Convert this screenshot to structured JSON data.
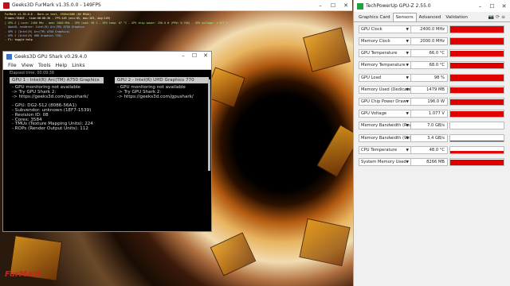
{
  "furmark": {
    "title": "Geeks3D FurMark v1.35.0.0 - 149FPS",
    "info_lines": [
      "FurMark v1.35.0.0 - Burn-in test, 1920x1080 (0X MSAA)",
      "Frames:78465 - time:00:08:36 - FPS:149 (min:65, max:163, avg:149)",
      "[ GPU-Z ] core: 2400 MHz - mem: 2000 MHz - GPU load: 98 % - GPU temp: 67 °C - GPU chip power: 196.0 W (PPW: 0.760) - GPU voltage: 1.077 V",
      "- OpenGL renderer: Intel(R) Arc(TM) A750 Graphics",
      "- GPU 1 (Intel(R) Arc(TM) A750 Graphics)",
      "- GPU 2 (Intel(R) UHD Graphics 770)",
      "- F1: toggle help"
    ],
    "logo_text": "FurMark"
  },
  "shark": {
    "title": "Geeks3D GPU Shark v0.29.4.0",
    "menu": [
      "File",
      "View",
      "Tools",
      "Help",
      "Links"
    ],
    "elapsed": "Elapsed time: 00:09:38",
    "gpu1": {
      "header": "GPU 1 - Intel(R) Arc(TM) A750 Graphics",
      "lines": [
        "- GPU monitoring not available",
        "  -> Try GPU Shark 2:",
        "  -> https://geeks3d.com/gpushark/",
        "",
        "- GPU: DG2-512 (8086-56A1)",
        "- Subvendor: unknown (1EF7-1539)",
        "- Revision ID: 08",
        "- Cores: 3584",
        "- TMUs (Texture Mapping Units): 224",
        "- ROPs (Render Output Units): 112"
      ]
    },
    "gpu2": {
      "header": "GPU 2 - Intel(R) UHD Graphics 770",
      "lines": [
        "- GPU monitoring not available",
        "  -> Try GPU Shark 2:",
        "  -> https://geeks3d.com/gpushark/"
      ]
    }
  },
  "gpuz": {
    "title": "TechPowerUp GPU-Z 2.55.0",
    "tabs": [
      "Graphics Card",
      "Sensors",
      "Advanced",
      "Validation"
    ],
    "active_tab": "Sensors",
    "accent": "#e00000",
    "sensors": [
      {
        "name": "GPU Clock",
        "value": "2400.0 MHz",
        "level": 0.95
      },
      {
        "name": "Memory Clock",
        "value": "2000.0 MHz",
        "level": 0.95
      },
      {
        "name": "GPU Temperature",
        "value": "66.0 °C",
        "level": 0.9
      },
      {
        "name": "Memory Temperature",
        "value": "68.0 °C",
        "level": 0.9
      },
      {
        "name": "GPU Load",
        "value": "98 %",
        "level": 0.95
      },
      {
        "name": "Memory Used (Dedicated)",
        "value": "1479 MB",
        "level": 0.9
      },
      {
        "name": "GPU Chip Power Draw",
        "value": "196.0 W",
        "level": 0.9
      },
      {
        "name": "GPU Voltage",
        "value": "1.077 V",
        "level": 0.9
      },
      {
        "name": "Memory Bandwidth (Read)",
        "value": "7.0 GB/s",
        "level": 0.1
      },
      {
        "name": "Memory Bandwidth (Write)",
        "value": "3.4 GB/s",
        "level": 0.1
      },
      {
        "name": "CPU Temperature",
        "value": "48.0 °C",
        "level": 0.3
      },
      {
        "name": "System Memory Used",
        "value": "8266 MB",
        "level": 0.9
      }
    ]
  }
}
